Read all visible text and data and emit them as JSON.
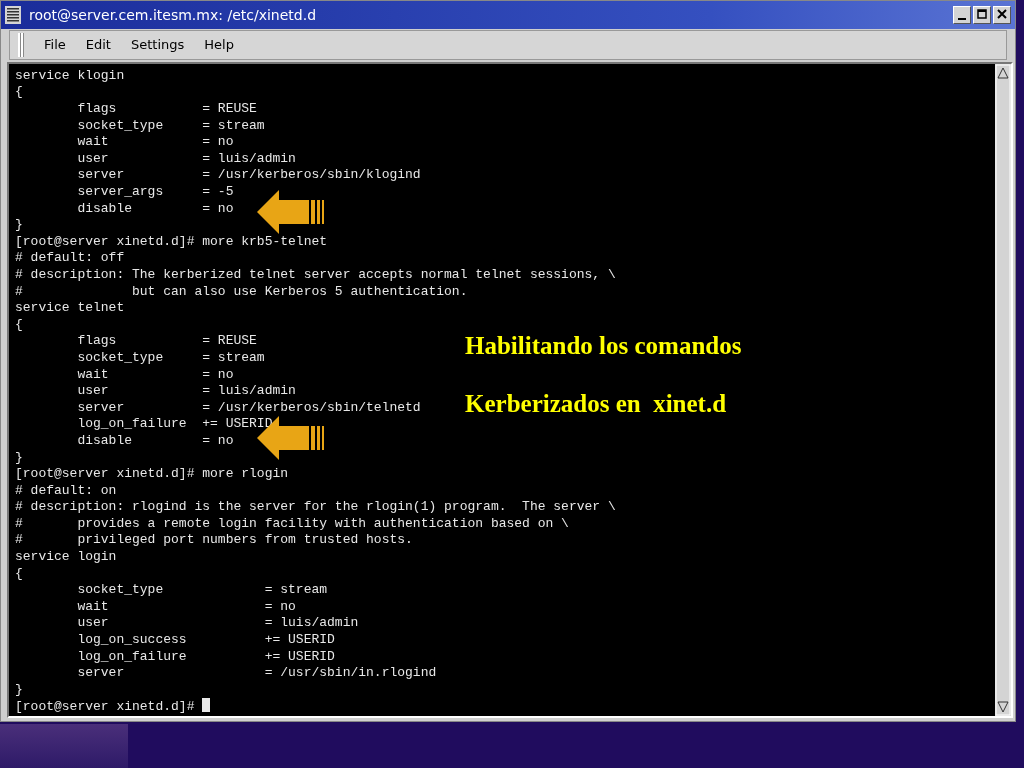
{
  "window": {
    "title": "root@server.cem.itesm.mx: /etc/xinetd.d"
  },
  "menu": [
    "File",
    "Edit",
    "Settings",
    "Help"
  ],
  "terminal": {
    "lines": [
      "service klogin",
      "{",
      "        flags           = REUSE",
      "        socket_type     = stream",
      "        wait            = no",
      "        user            = luis/admin",
      "        server          = /usr/kerberos/sbin/klogind",
      "        server_args     = -5",
      "        disable         = no",
      "}",
      "[root@server xinetd.d]# more krb5-telnet",
      "# default: off",
      "# description: The kerberized telnet server accepts normal telnet sessions, \\",
      "#              but can also use Kerberos 5 authentication.",
      "service telnet",
      "{",
      "        flags           = REUSE",
      "        socket_type     = stream",
      "        wait            = no",
      "        user            = luis/admin",
      "        server          = /usr/kerberos/sbin/telnetd",
      "        log_on_failure  += USERID",
      "        disable         = no",
      "}",
      "[root@server xinetd.d]# more rlogin",
      "# default: on",
      "# description: rlogind is the server for the rlogin(1) program.  The server \\",
      "#       provides a remote login facility with authentication based on \\",
      "#       privileged port numbers from trusted hosts.",
      "service login",
      "{",
      "        socket_type             = stream",
      "        wait                    = no",
      "        user                    = luis/admin",
      "        log_on_success          += USERID",
      "        log_on_failure          += USERID",
      "        server                  = /usr/sbin/in.rlogind",
      "}",
      "[root@server xinetd.d]# "
    ]
  },
  "annotation": [
    "Habilitando los comandos",
    "Kerberizados en  xinet.d"
  ]
}
